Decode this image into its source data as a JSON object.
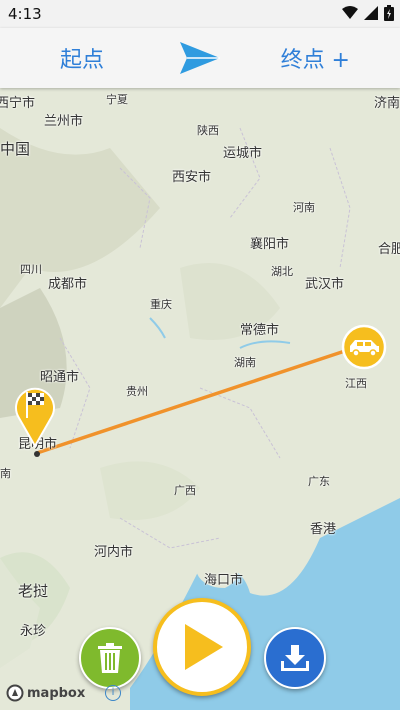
{
  "status": {
    "time": "4:13"
  },
  "toolbar": {
    "start_label": "起点",
    "end_label": "终点 +"
  },
  "map": {
    "labels": {
      "xining": "西宁市",
      "ningxia": "宁夏",
      "jinan": "济南",
      "lanzhou": "兰州市",
      "shaanxi": "陕西",
      "china": "中国",
      "yuncheng": "运城市",
      "xian": "西安市",
      "henan": "河南",
      "xiangyang": "襄阳市",
      "hefei": "合肥",
      "sichuan": "四川",
      "hubei": "湖北",
      "chengdu": "成都市",
      "wuhan": "武汉市",
      "chongqing": "重庆",
      "changde": "常德市",
      "hunan": "湖南",
      "zhaotong": "昭通市",
      "guizhou": "贵州",
      "jiangxi": "江西",
      "kunming": "昆明市",
      "south": "南",
      "guangxi": "广西",
      "guangdong": "广东",
      "hongkong": "香港",
      "hanoi": "河内市",
      "haikou": "海口市",
      "laos": "老挝",
      "yongzhen": "永珍"
    },
    "attribution": "mapbox"
  },
  "colors": {
    "accent": "#2f7fd8",
    "route": "#f0922b",
    "marker": "#f6be1e",
    "trash": "#7fba2d",
    "download": "#2a6ed0",
    "water": "#8fcbe8"
  },
  "icons": {
    "start_marker": "checkered-flag-icon",
    "end_marker": "car-icon"
  }
}
